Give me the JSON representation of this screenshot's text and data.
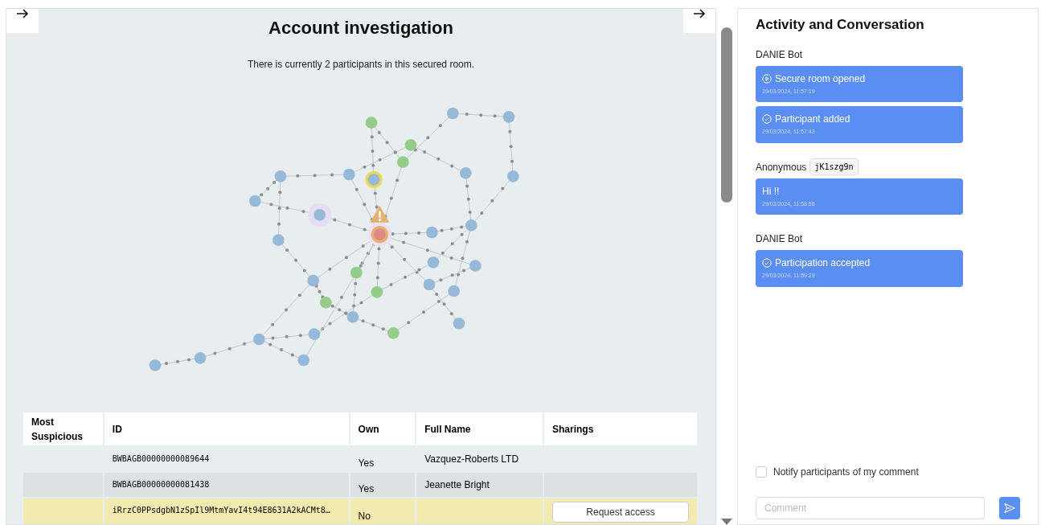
{
  "investigation": {
    "title": "Account investigation",
    "subtitle": "There is currently 2 participants in this secured room."
  },
  "table": {
    "columns": [
      "Most Suspicious",
      "ID",
      "Own",
      "Full Name",
      "Sharings"
    ],
    "rows": [
      {
        "most_suspicious": "",
        "id": "BWBAGB00000000089644",
        "own": "Yes",
        "full_name": "Vazquez-Roberts LTD",
        "flagged": false
      },
      {
        "most_suspicious": "",
        "id": "BWBAGB00000000081438",
        "own": "Yes",
        "full_name": "Jeanette Bright",
        "flagged": false
      },
      {
        "most_suspicious": "",
        "id": "iRrzC0PPsdgbN1zSpIl9MtmYavI4t94E8631A2kACMt8…",
        "own": "No",
        "full_name": "",
        "flagged": true,
        "action": "Request access"
      }
    ]
  },
  "activity": {
    "title": "Activity and Conversation",
    "groups": [
      {
        "author": "DANIE Bot",
        "messages": [
          {
            "kind": "event-play",
            "text": "Secure room opened",
            "time": "29/03/2024, 11:57:19"
          },
          {
            "kind": "event-check",
            "text": "Participant added",
            "time": "29/03/2024, 11:57:43"
          }
        ]
      },
      {
        "author": "Anonymous",
        "tag": "jK1szg9n",
        "messages": [
          {
            "kind": "comment",
            "text": "Hi !!",
            "time": "29/03/2024, 11:58:58"
          }
        ]
      },
      {
        "author": "DANIE Bot",
        "messages": [
          {
            "kind": "event-check",
            "text": "Participation accepted",
            "time": "29/03/2024, 11:59:29"
          }
        ]
      }
    ],
    "notify": {
      "label": "Notify participants of my comment",
      "checked": false
    },
    "comment": {
      "placeholder": "Comment"
    }
  }
}
